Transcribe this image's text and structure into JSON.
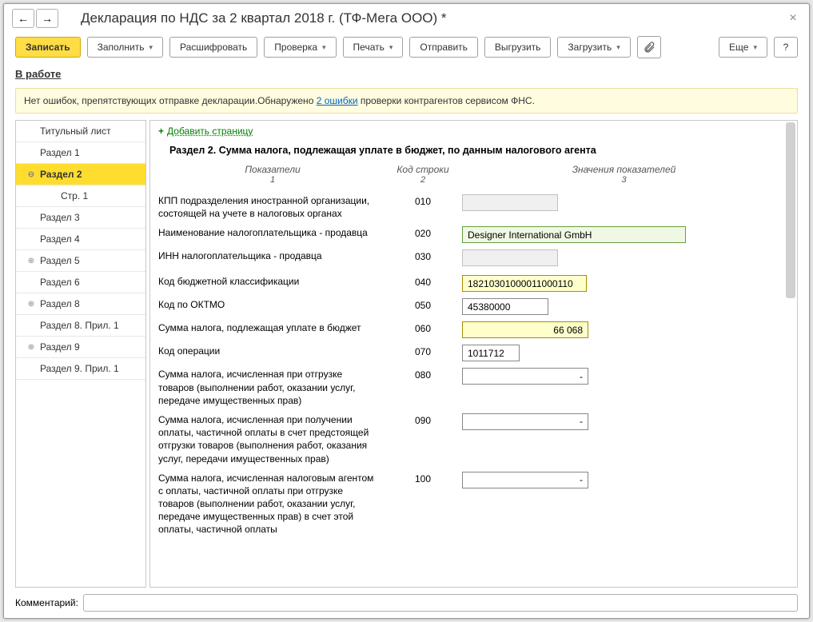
{
  "header": {
    "title": "Декларация по НДС за 2 квартал 2018 г. (ТФ-Мега ООО) *"
  },
  "toolbar": {
    "write": "Записать",
    "fill": "Заполнить",
    "decipher": "Расшифровать",
    "check": "Проверка",
    "print": "Печать",
    "send": "Отправить",
    "export": "Выгрузить",
    "import": "Загрузить",
    "more": "Еще",
    "help": "?"
  },
  "status_link": "В работе",
  "info": {
    "prefix": "Нет ошибок, препятствующих отправке декларации.Обнаружено ",
    "link": "2 ошибки",
    "suffix": " проверки контрагентов сервисом ФНС."
  },
  "sidebar": {
    "items": [
      {
        "label": "Титульный лист",
        "level": 0,
        "exp": ""
      },
      {
        "label": "Раздел 1",
        "level": 0,
        "exp": ""
      },
      {
        "label": "Раздел 2",
        "level": 0,
        "exp": "⊖",
        "selected": true
      },
      {
        "label": "Стр. 1",
        "level": 1,
        "exp": ""
      },
      {
        "label": "Раздел 3",
        "level": 0,
        "exp": ""
      },
      {
        "label": "Раздел 4",
        "level": 0,
        "exp": ""
      },
      {
        "label": "Раздел 5",
        "level": 0,
        "exp": "⊕"
      },
      {
        "label": "Раздел 6",
        "level": 0,
        "exp": ""
      },
      {
        "label": "Раздел 8",
        "level": 0,
        "exp": "⊕"
      },
      {
        "label": "Раздел 8. Прил. 1",
        "level": 0,
        "exp": ""
      },
      {
        "label": "Раздел 9",
        "level": 0,
        "exp": "⊕"
      },
      {
        "label": "Раздел 9. Прил. 1",
        "level": 0,
        "exp": ""
      }
    ]
  },
  "content": {
    "add_page": "Добавить страницу",
    "section_title": "Раздел 2. Сумма налога, подлежащая уплате в бюджет, по данным налогового агента",
    "col_headers": {
      "c1": "Показатели",
      "n1": "1",
      "c2": "Код строки",
      "n2": "2",
      "c3": "Значения показателей",
      "n3": "3"
    },
    "rows": [
      {
        "label": "КПП подразделения иностранной организации, состоящей на учете в налоговых органах",
        "code": "010",
        "value": "",
        "cls": "small readonly"
      },
      {
        "label": "Наименование налогоплательщика - продавца",
        "code": "020",
        "value": "Designer International GmbH",
        "cls": "wide green-border"
      },
      {
        "label": "ИНН налогоплательщика - продавца",
        "code": "030",
        "value": "",
        "cls": "small readonly"
      },
      {
        "label": "Код бюджетной классификации",
        "code": "040",
        "value": "18210301000011000110",
        "cls": "kbk yellow"
      },
      {
        "label": "Код по ОКТМО",
        "code": "050",
        "value": "45380000",
        "cls": "num"
      },
      {
        "label": "Сумма налога, подлежащая уплате в бюджет",
        "code": "060",
        "value": "66 068",
        "cls": "med yellow"
      },
      {
        "label": "Код операции",
        "code": "070",
        "value": "1011712",
        "cls": "code"
      },
      {
        "label": "Сумма налога, исчисленная при отгрузке товаров (выполнении работ, оказании услуг, передаче имущественных прав)",
        "code": "080",
        "value": "-",
        "cls": "med"
      },
      {
        "label": "Сумма налога, исчисленная при получении оплаты, частичной оплаты в счет предстоящей отгрузки товаров (выполнения работ, оказания услуг, передачи имущественных прав)",
        "code": "090",
        "value": "-",
        "cls": "med"
      },
      {
        "label": "Сумма налога, исчисленная налоговым агентом с оплаты, частичной оплаты при отгрузке товаров (выполнении работ, оказании услуг, передаче имущественных прав) в счет этой оплаты, частичной оплаты",
        "code": "100",
        "value": "-",
        "cls": "med"
      }
    ]
  },
  "footer": {
    "label": "Комментарий:",
    "value": ""
  }
}
